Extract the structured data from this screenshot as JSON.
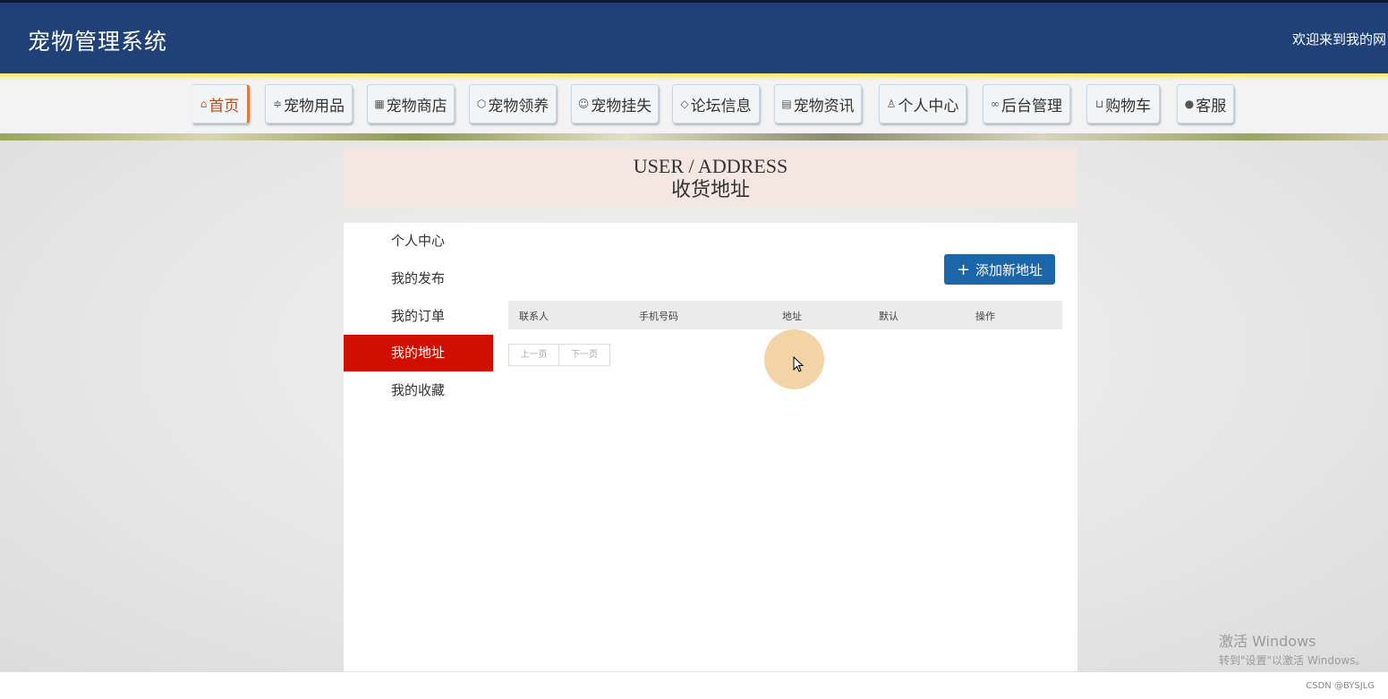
{
  "header": {
    "title": "宠物管理系统",
    "welcome": "欢迎来到我的网"
  },
  "nav": {
    "items": [
      {
        "label": "首页",
        "icon": "home-icon",
        "glyph": "⌂"
      },
      {
        "label": "宠物用品",
        "icon": "sliders-icon",
        "glyph": "≑"
      },
      {
        "label": "宠物商店",
        "icon": "store-icon",
        "glyph": "▦"
      },
      {
        "label": "宠物领养",
        "icon": "box-icon",
        "glyph": "⬡"
      },
      {
        "label": "宠物挂失",
        "icon": "face-icon",
        "glyph": "☺"
      },
      {
        "label": "论坛信息",
        "icon": "tag-icon",
        "glyph": "◇"
      },
      {
        "label": "宠物资讯",
        "icon": "document-icon",
        "glyph": "▤"
      },
      {
        "label": "个人中心",
        "icon": "user-icon",
        "glyph": "♙"
      },
      {
        "label": "后台管理",
        "icon": "link-icon",
        "glyph": "∞"
      },
      {
        "label": "购物车",
        "icon": "cart-icon",
        "glyph": "⊔"
      },
      {
        "label": "客服",
        "icon": "support-icon",
        "glyph": "●"
      }
    ]
  },
  "title_box": {
    "en": "USER / ADDRESS",
    "cn": "收货地址"
  },
  "sidebar": {
    "items": [
      {
        "label": "个人中心"
      },
      {
        "label": "我的发布"
      },
      {
        "label": "我的订单"
      },
      {
        "label": "我的地址",
        "active": true
      },
      {
        "label": "我的收藏"
      }
    ]
  },
  "add_button": {
    "label": "添加新地址",
    "icon": "plus-icon"
  },
  "table": {
    "columns": [
      "联系人",
      "手机号码",
      "地址",
      "默认",
      "操作"
    ],
    "rows": []
  },
  "pager": {
    "prev": "上一页",
    "next": "下一页"
  },
  "watermark": {
    "windows_line1": "激活 Windows",
    "windows_line2": "转到\"设置\"以激活 Windows。",
    "csdn": "CSDN @BYSJLG"
  },
  "colors": {
    "header_bg": "#1f4178",
    "active_side": "#d10f00",
    "add_button": "#1a66a8",
    "title_box_bg": "#f4e7e1"
  }
}
